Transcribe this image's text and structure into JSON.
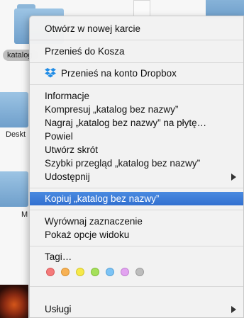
{
  "background": {
    "selected_folder_label": "katalog",
    "desktop_label": "Deskt",
    "m_label": "M"
  },
  "menu": {
    "group1": [
      {
        "label": "Otwórz w nowej karcie"
      }
    ],
    "group2": [
      {
        "label": "Przenieś do Kosza"
      }
    ],
    "group3": [
      {
        "label": "Przenieś na konto Dropbox",
        "icon": "dropbox-icon"
      }
    ],
    "group4": [
      {
        "label": "Informacje"
      },
      {
        "label": "Kompresuj „katalog bez nazwy”"
      },
      {
        "label": "Nagraj „katalog bez nazwy” na płytę…"
      },
      {
        "label": "Powiel"
      },
      {
        "label": "Utwórz skrót"
      },
      {
        "label": "Szybki przegląd „katalog bez nazwy”"
      },
      {
        "label": "Udostępnij",
        "submenu": true
      }
    ],
    "highlighted": {
      "label": "Kopiuj „katalog bez nazwy”"
    },
    "group6": [
      {
        "label": "Wyrównaj zaznaczenie"
      },
      {
        "label": "Pokaż opcje widoku"
      }
    ],
    "tags_label": "Tagi…",
    "tag_colors": [
      {
        "name": "red",
        "fill": "#f47a7a",
        "stroke": "#d85a5a"
      },
      {
        "name": "orange",
        "fill": "#f7b154",
        "stroke": "#d99333"
      },
      {
        "name": "yellow",
        "fill": "#f6e94a",
        "stroke": "#d4c62c"
      },
      {
        "name": "green",
        "fill": "#a5e05a",
        "stroke": "#84be3b"
      },
      {
        "name": "blue",
        "fill": "#7cc3f5",
        "stroke": "#5aa3d6"
      },
      {
        "name": "purple",
        "fill": "#e2a3f0",
        "stroke": "#c282d2"
      },
      {
        "name": "gray",
        "fill": "#bdbdbd",
        "stroke": "#9c9c9c"
      }
    ],
    "services": {
      "label": "Usługi",
      "submenu": true
    }
  },
  "colors": {
    "highlight": "#3b78d8"
  }
}
